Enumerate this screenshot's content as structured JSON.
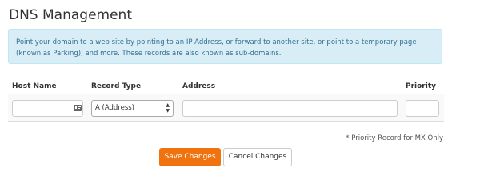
{
  "page": {
    "title": "DNS Management"
  },
  "info_alert": {
    "text": "Point your domain to a web site by pointing to an IP Address, or forward to another site, or point to a temporary page (known as Parking), and more. These records are also known as sub-domains."
  },
  "table": {
    "headers": {
      "host_name": "Host Name",
      "record_type": "Record Type",
      "address": "Address",
      "priority": "Priority"
    },
    "row": {
      "host_name_value": "",
      "record_type_value": "A (Address)",
      "address_value": "",
      "priority_value": ""
    }
  },
  "footnote": "* Priority Record for MX Only",
  "buttons": {
    "save_label": "Save Changes",
    "cancel_label": "Cancel Changes"
  },
  "icons": {
    "host_field_icon": "contact-card-icon",
    "select_icon": "up-down-arrows-icon"
  },
  "colors": {
    "primary_button": "#f0730f",
    "alert_background": "#d9edf7",
    "alert_text": "#31708f"
  }
}
